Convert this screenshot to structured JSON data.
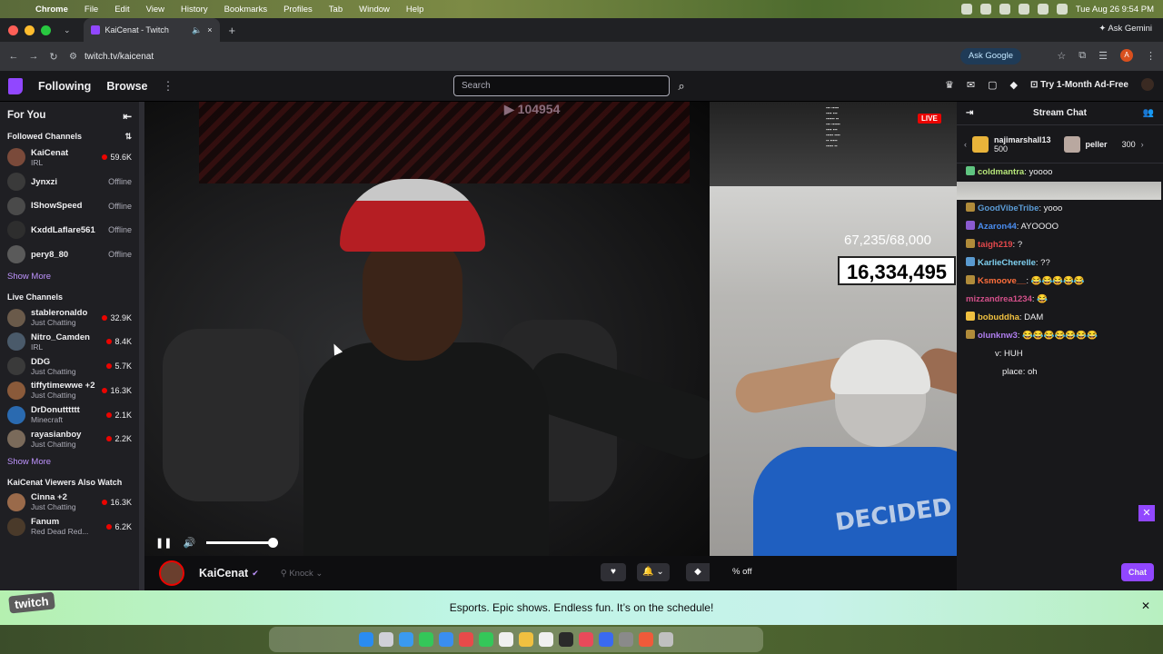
{
  "menubar": {
    "app": "Chrome",
    "items": [
      "File",
      "Edit",
      "View",
      "History",
      "Bookmarks",
      "Profiles",
      "Tab",
      "Window",
      "Help"
    ],
    "datetime": "Tue Aug 26  9:54 PM"
  },
  "browser": {
    "tab_title": "KaiCenat - Twitch",
    "ask_gemini": "Ask Gemini",
    "url": "twitch.tv/kaicenat",
    "ask_google": "Ask Google",
    "profile_initial": "A"
  },
  "twitch": {
    "nav": {
      "following": "Following",
      "browse": "Browse"
    },
    "search_placeholder": "Search",
    "ad_free": "Try 1-Month Ad-Free"
  },
  "sidebar": {
    "title": "For You",
    "followed_title": "Followed Channels",
    "followed": [
      {
        "name": "KaiCenat",
        "game": "IRL",
        "viewers": "59.6K",
        "live": true
      },
      {
        "name": "Jynxzi",
        "game": "",
        "viewers": "Offline",
        "live": false
      },
      {
        "name": "IShowSpeed",
        "game": "",
        "viewers": "Offline",
        "live": false
      },
      {
        "name": "KxddLaflare561",
        "game": "",
        "viewers": "Offline",
        "live": false
      },
      {
        "name": "pery8_80",
        "game": "",
        "viewers": "Offline",
        "live": false
      }
    ],
    "show_more": "Show More",
    "live_title": "Live Channels",
    "live": [
      {
        "name": "stableronaldo",
        "game": "Just Chatting",
        "viewers": "32.9K"
      },
      {
        "name": "Nitro_Camden",
        "game": "IRL",
        "viewers": "8.4K"
      },
      {
        "name": "DDG",
        "game": "Just Chatting",
        "viewers": "5.7K"
      },
      {
        "name": "tiffytimewwe +2",
        "game": "Just Chatting",
        "viewers": "16.3K"
      },
      {
        "name": "DrDonutttttt",
        "game": "Minecraft",
        "viewers": "2.1K"
      },
      {
        "name": "rayasianboy",
        "game": "Just Chatting",
        "viewers": "2.2K"
      }
    ],
    "also_watch_title": "KaiCenat Viewers Also Watch",
    "also_watch": [
      {
        "name": "Cinna +2",
        "game": "Just Chatting",
        "viewers": "16.3K"
      },
      {
        "name": "Fanum",
        "game": "Red Dead Red...",
        "viewers": "6.2K"
      }
    ]
  },
  "player": {
    "yt_count": "104954",
    "live_label": "LIVE",
    "overlay_count_small": "67,235/68,000",
    "overlay_count_big": "16,334,495",
    "shirt_text": "DECIDED",
    "volume_level": 1.0
  },
  "stream_info": {
    "streamer": "KaiCenat",
    "knock": "Knock",
    "percent_off": "% off"
  },
  "chat": {
    "title": "Stream Chat",
    "gifts": [
      {
        "name": "najimarshall13",
        "count": "500"
      },
      {
        "name": "peller",
        "count": "300"
      }
    ],
    "messages": [
      {
        "user": "coldmantra",
        "text": ": yoooo",
        "color": "#b7e77a"
      },
      {
        "user": "GoodVibeTribe",
        "text": ": yooo",
        "color": "#5b9bd5"
      },
      {
        "user": "Azaron44",
        "text": ": AYOOOO",
        "color": "#4a8df0"
      },
      {
        "user": "taigh219",
        "text": ": ?",
        "color": "#e3484b"
      },
      {
        "user": "KarlieCherelle",
        "text": ": ??",
        "color": "#7fd0f0"
      },
      {
        "user": "Ksmoove__",
        "text": ": 😂😂😂😂😂",
        "color": "#ff6f3c"
      },
      {
        "user": "mizzandrea1234",
        "text": ": 😂",
        "color": "#d4508a"
      },
      {
        "user": "bobuddha",
        "text": ": DAM",
        "color": "#f0c040"
      },
      {
        "user": "olunknw3",
        "text": ": 😂😂😂😂😂😂😂",
        "color": "#b07ef0"
      },
      {
        "user": "",
        "text": "v: HUH",
        "color": "#efeff1"
      },
      {
        "user": "",
        "text": "place: oh",
        "color": "#efeff1"
      }
    ],
    "chat_button": "Chat"
  },
  "banner": {
    "text": "Esports. Epic shows. Endless fun. It’s on the schedule!",
    "logo": "twitch"
  },
  "colors": {
    "twitch_purple": "#9147ff",
    "live_red": "#eb0400",
    "link_purple": "#bf94ff"
  }
}
